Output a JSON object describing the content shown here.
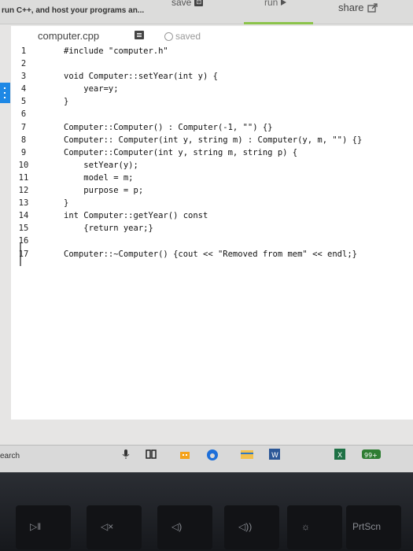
{
  "app": {
    "title": "run C++, and host your programs an...",
    "save_label": "save",
    "run_label": "run",
    "share_label": "share",
    "accent_color": "#8bc34a"
  },
  "editor": {
    "filename": "computer.cpp",
    "status": "saved",
    "line_numbers": [
      "1",
      "2",
      "3",
      "4",
      "5",
      "6",
      "7",
      "8",
      "9",
      "10",
      "11",
      "12",
      "13",
      "14",
      "15",
      "16",
      "17"
    ],
    "lines": [
      "#include \"computer.h\"",
      "",
      "void Computer::setYear(int y) {",
      "    year=y;",
      "}",
      "",
      "Computer::Computer() : Computer(-1, \"\") {}",
      "Computer:: Computer(int y, string m) : Computer(y, m, \"\") {}",
      "Computer::Computer(int y, string m, string p) {",
      "    setYear(y);",
      "    model = m;",
      "    purpose = p;",
      "}",
      "int Computer::getYear() const",
      "    {return year;}",
      "",
      "Computer::~Computer() {cout << \"Removed from mem\" << endl;}"
    ]
  },
  "taskbar": {
    "search_label": "earch",
    "badge": "99+"
  },
  "keyboard": {
    "prtscn_label": "PrtScn"
  }
}
